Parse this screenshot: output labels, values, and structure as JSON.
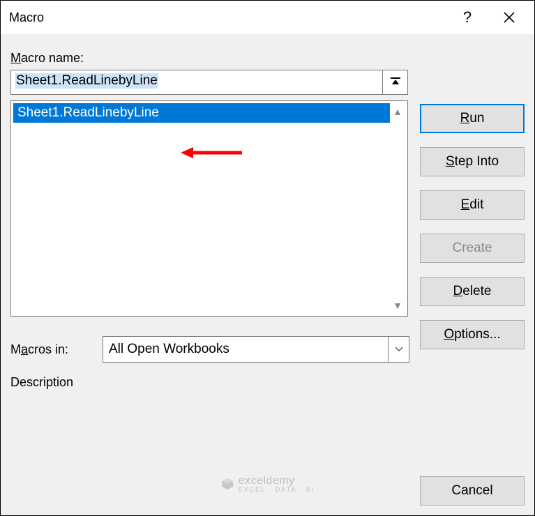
{
  "dialog": {
    "title": "Macro",
    "macro_name_label_pre": "M",
    "macro_name_label_post": "acro name:",
    "macro_name_value": "Sheet1.ReadLinebyLine",
    "list_items": [
      "Sheet1.ReadLinebyLine"
    ],
    "macros_in_label_pre": "M",
    "macros_in_label_mid": "a",
    "macros_in_label_post": "cros in:",
    "macros_in_value": "All Open Workbooks",
    "description_label": "Description"
  },
  "buttons": {
    "run": "Run",
    "run_u": "R",
    "step_into_pre": "S",
    "step_into_post": "tep Into",
    "edit_pre": "E",
    "edit_post": "dit",
    "create": "Create",
    "delete_pre": "D",
    "delete_post": "elete",
    "options_pre": "O",
    "options_post": "ptions...",
    "cancel": "Cancel"
  },
  "watermark": {
    "brand": "exceldemy",
    "tagline": "EXCEL · DATA · BI"
  }
}
